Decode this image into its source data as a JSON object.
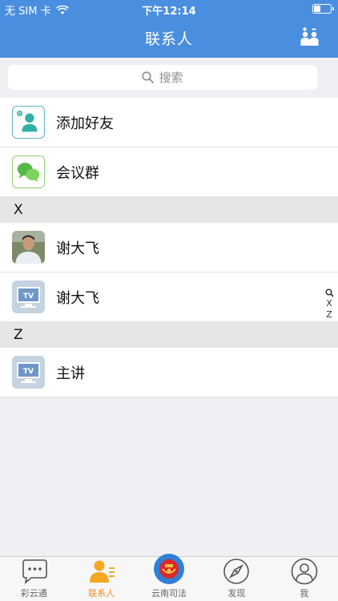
{
  "status_bar": {
    "carrier": "无 SIM 卡",
    "time": "下午12:14",
    "battery_level": 0.35
  },
  "header": {
    "title": "联系人"
  },
  "search": {
    "placeholder": "搜索"
  },
  "top_items": [
    {
      "label": "添加好友",
      "icon": "add-friend-icon"
    },
    {
      "label": "会议群",
      "icon": "chat-group-icon"
    }
  ],
  "sections": [
    {
      "letter": "X",
      "items": [
        {
          "label": "谢大飞",
          "icon": "avatar"
        },
        {
          "label": "谢大飞",
          "icon": "tv-icon"
        }
      ]
    },
    {
      "letter": "Z",
      "items": [
        {
          "label": "主讲",
          "icon": "tv-icon"
        }
      ]
    }
  ],
  "index_bar": [
    "X",
    "Z"
  ],
  "tabs": [
    {
      "label": "彩云通",
      "icon": "chat-bubble-icon",
      "active": false
    },
    {
      "label": "联系人",
      "icon": "contacts-icon",
      "active": true
    },
    {
      "label": "云南司法",
      "icon": "emblem-icon",
      "active": false
    },
    {
      "label": "发现",
      "icon": "compass-icon",
      "active": false
    },
    {
      "label": "我",
      "icon": "profile-icon",
      "active": false
    }
  ],
  "colors": {
    "header": "#4a8ee0",
    "active_tab": "#f08c1e",
    "tv_icon_bg": "#c5d2e0",
    "tv_screen": "#6f97c7"
  }
}
